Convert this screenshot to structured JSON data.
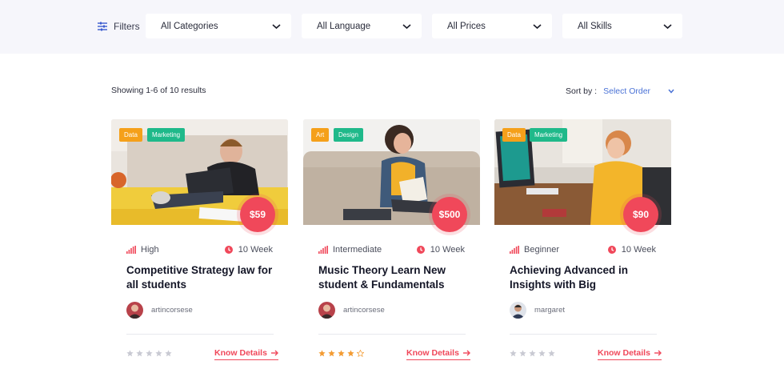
{
  "filters": {
    "label": "Filters",
    "icon": "sliders-icon",
    "categories": "All Categories",
    "language": "All Language",
    "prices": "All Prices",
    "skills": "All Skills"
  },
  "results_text": "Showing 1-6 of 10 results",
  "sort": {
    "label": "Sort by :",
    "value": "Select Order"
  },
  "colors": {
    "accent": "#f0485a",
    "tag_orange": "#f5a01a",
    "tag_green": "#1fb98a",
    "link_blue": "#4a72d6",
    "star_filled": "#f39c34",
    "star_empty": "#c9cad3"
  },
  "cards": [
    {
      "tags": [
        "Data",
        "Marketing"
      ],
      "price": "$59",
      "level": "High",
      "duration": "10 Week",
      "title": "Competitive Strategy law for all students",
      "author": "artincorsese",
      "rating": 0,
      "link": "Know Details"
    },
    {
      "tags": [
        "Art",
        "Design"
      ],
      "price": "$500",
      "level": "Intermediate",
      "duration": "10 Week",
      "title": "Music Theory Learn New student & Fundamentals",
      "author": "artincorsese",
      "rating": 4,
      "link": "Know Details"
    },
    {
      "tags": [
        "Data",
        "Marketing"
      ],
      "price": "$90",
      "level": "Beginner",
      "duration": "10 Week",
      "title": "Achieving Advanced in Insights with Big",
      "author": "margaret",
      "rating": 0,
      "link": "Know Details"
    }
  ]
}
